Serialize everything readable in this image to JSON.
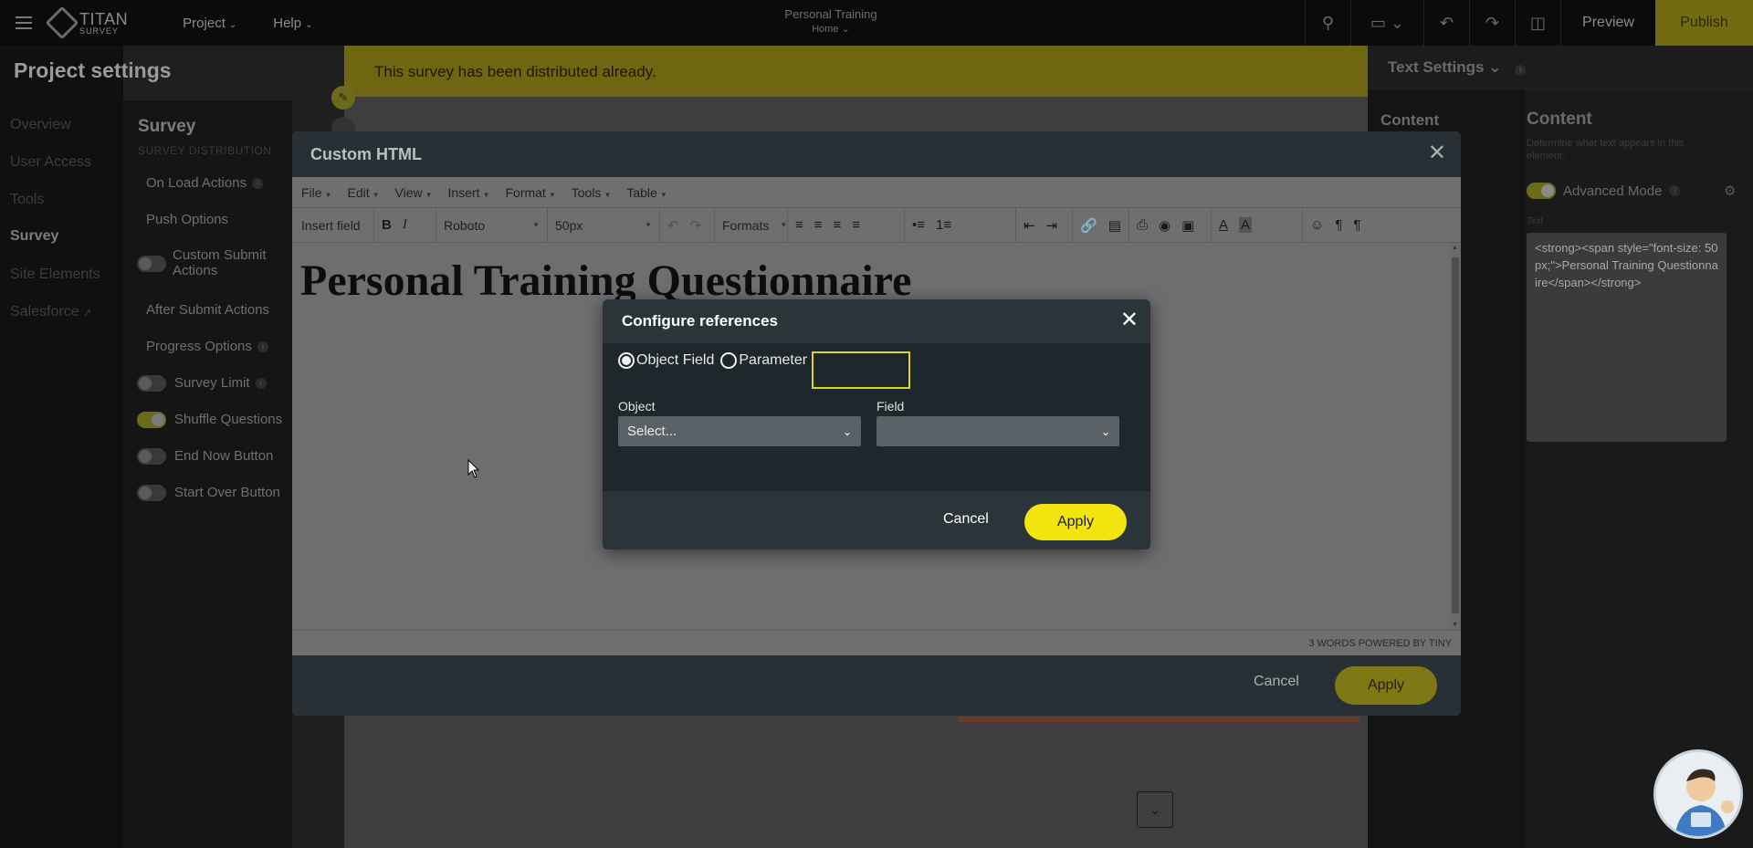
{
  "topbar": {
    "logo_line1": "TITAN",
    "logo_line2": "SURVEY",
    "menu": [
      {
        "label": "Project"
      },
      {
        "label": "Help"
      }
    ],
    "page_title": "Personal Training",
    "page_subtitle": "Home",
    "preview_label": "Preview",
    "publish_label": "Publish",
    "icons": [
      "search-icon",
      "desktop-icon",
      "undo-icon",
      "redo-icon",
      "save-icon"
    ]
  },
  "project_settings": {
    "title": "Project settings",
    "nav": [
      "Overview",
      "User Access",
      "Tools",
      "Survey",
      "Site Elements",
      "Salesforce"
    ],
    "active_nav": "Survey"
  },
  "survey_panel": {
    "title": "Survey",
    "section": "SURVEY DISTRIBUTION",
    "items": [
      {
        "label": "On Load Actions",
        "info": true
      },
      {
        "label": "Push Options"
      },
      {
        "label": "Custom Submit Actions",
        "toggle": "off"
      },
      {
        "label": "After Submit Actions"
      },
      {
        "label": "Progress Options",
        "info": true
      },
      {
        "label": "Survey Limit",
        "toggle": "off",
        "info": true
      },
      {
        "label": "Shuffle Questions",
        "toggle": "on"
      },
      {
        "label": "End Now Button",
        "toggle": "off"
      },
      {
        "label": "Start Over Button",
        "toggle": "off"
      }
    ]
  },
  "banner": {
    "text": "This survey has been distributed already."
  },
  "right_panel": {
    "title": "Text Settings",
    "col1_title": "Content",
    "col2_title": "Content",
    "description": "Determine what text appears in this element.",
    "advanced_mode_label": "Advanced Mode",
    "text_label": "Text",
    "text_value": "<strong><span style=\"font-size: 50px;\">Personal Training Questionnaire</span></strong>"
  },
  "custom_html_modal": {
    "title": "Custom HTML",
    "menubar": [
      "File",
      "Edit",
      "View",
      "Insert",
      "Format",
      "Tools",
      "Table"
    ],
    "toolbar": {
      "insert_field": "Insert field",
      "font_family": "Roboto",
      "font_size": "50px",
      "formats": "Formats",
      "bold": "B",
      "italic": "I"
    },
    "content_heading": "Personal Training Questionnaire",
    "status": "3 WORDS POWERED BY TINY",
    "cancel_label": "Cancel",
    "apply_label": "Apply"
  },
  "configure_references": {
    "title": "Configure references",
    "radio_object_field": "Object Field",
    "radio_parameter": "Parameter",
    "selected_radio": "Object Field",
    "parameter_value": "",
    "object_label": "Object",
    "object_value": "Select...",
    "field_label": "Field",
    "field_value": "",
    "cancel_label": "Cancel",
    "apply_label": "Apply"
  },
  "colors": {
    "accent_yellow": "#f1e40f",
    "banner_yellow": "#6e6611",
    "dialog_bg": "#1e272c"
  }
}
